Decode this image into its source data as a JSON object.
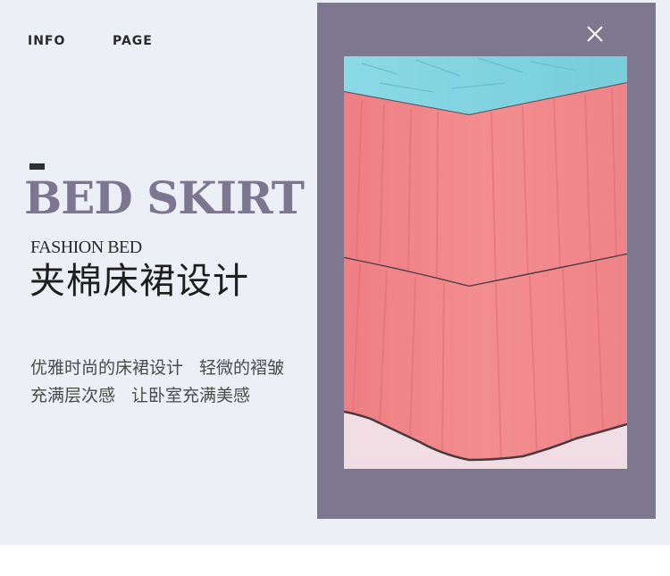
{
  "nav": {
    "info": "INFO",
    "page": "PAGE"
  },
  "hero": {
    "title": "BED SKIRT",
    "subtitle": "FASHION BED",
    "heading_cn": "夹棉床裙设计"
  },
  "description": {
    "line1_a": "优雅时尚的床裙设计",
    "line1_b": "轻微的褶皱",
    "line2_a": "充满层次感",
    "line2_b": "让卧室充满美感"
  },
  "panel": {
    "close_icon": "close-icon",
    "photo_subject": "pink-ruffled-bed-skirt-photo"
  },
  "colors": {
    "banner_bg": "#eceff6",
    "panel_bg": "#7e7790",
    "title_accent": "#7c7690",
    "skirt_pink": "#f0868a",
    "quilt_blue": "#7fd3e0"
  }
}
